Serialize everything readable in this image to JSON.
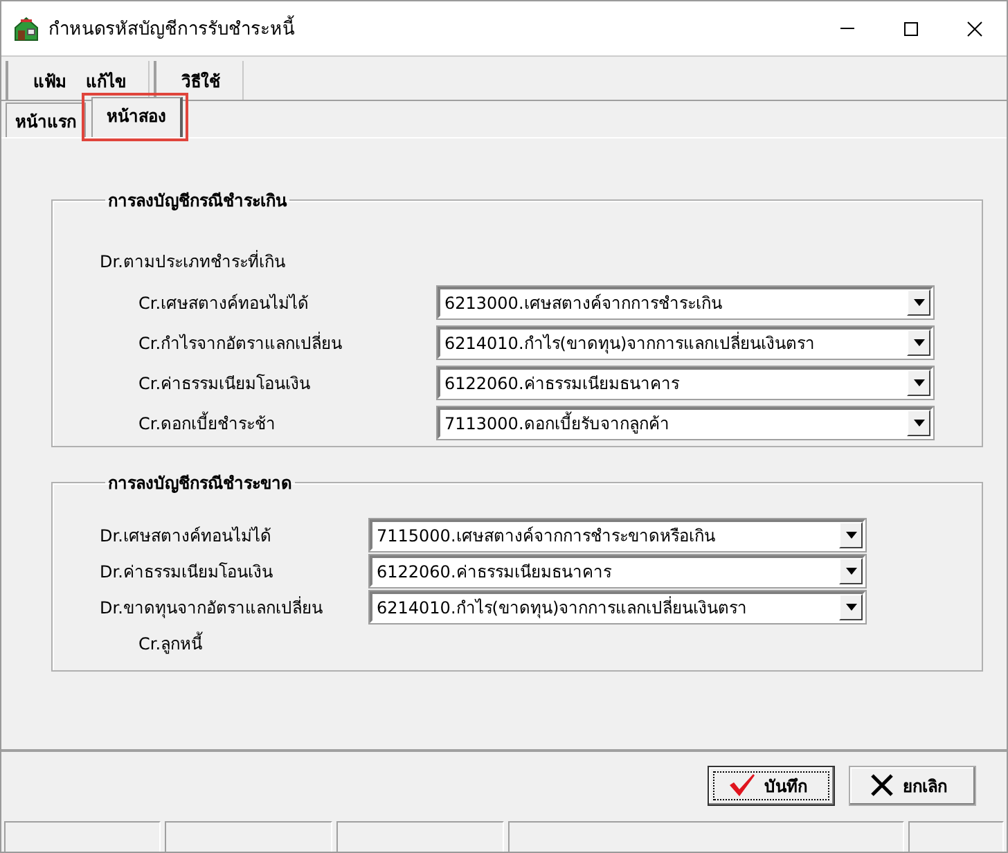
{
  "window": {
    "title": "กำหนดรหัสบัญชีการรับชำระหนี้"
  },
  "menu": [
    {
      "items": [
        "แฟ้ม",
        "แก้ไข"
      ]
    },
    {
      "items": [
        "วิธีใช้"
      ]
    }
  ],
  "tabs": [
    {
      "label": "หน้าแรก",
      "selected": false,
      "highlighted": false
    },
    {
      "label": "หน้าสอง",
      "selected": true,
      "highlighted": true
    }
  ],
  "sections": [
    {
      "title": "การลงบัญชีกรณีชำระเกิน",
      "header_note": "Dr.ตามประเภทชำระที่เกิน",
      "rows": [
        {
          "label": "Cr.เศษสตางค์ทอนไม่ได้",
          "value": "6213000.เศษสตางค์จากการชำระเกิน"
        },
        {
          "label": "Cr.กำไรจากอัตราแลกเปลี่ยน",
          "value": "6214010.กำไร(ขาดทุน)จากการแลกเปลี่ยนเงินตรา"
        },
        {
          "label": "Cr.ค่าธรรมเนียมโอนเงิน",
          "value": "6122060.ค่าธรรมเนียมธนาคาร"
        },
        {
          "label": "Cr.ดอกเบี้ยชำระช้า",
          "value": "7113000.ดอกเบี้ยรับจากลูกค้า"
        }
      ]
    },
    {
      "title": "การลงบัญชีกรณีชำระขาด",
      "footer_note": "Cr.ลูกหนี้",
      "rows": [
        {
          "label": "Dr.เศษสตางค์ทอนไม่ได้",
          "value": "7115000.เศษสตางค์จากการชำระขาดหรือเกิน"
        },
        {
          "label": "Dr.ค่าธรรมเนียมโอนเงิน",
          "value": "6122060.ค่าธรรมเนียมธนาคาร"
        },
        {
          "label": "Dr.ขาดทุนจากอัตราแลกเปลี่ยน",
          "value": "6214010.กำไร(ขาดทุน)จากการแลกเปลี่ยนเงินตรา"
        }
      ]
    }
  ],
  "buttons": [
    {
      "kind": "save",
      "label": "บันทึก",
      "focused": true
    },
    {
      "kind": "cancel",
      "label": "ยกเลิก",
      "focused": false
    }
  ]
}
